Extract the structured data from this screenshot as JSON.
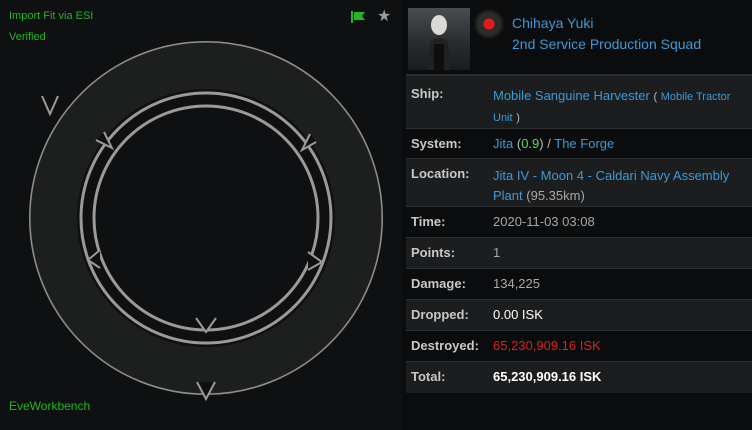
{
  "fitting": {
    "import_link": "Import Fit via ESI",
    "verified": "Verified",
    "eveworkbench": "EveWorkbench"
  },
  "victim": {
    "name": "Chihaya Yuki",
    "corporation": "2nd Service Production Squad"
  },
  "info": {
    "ship_label": "Ship:",
    "ship_name": "Mobile Sanguine Harvester",
    "ship_open_paren": "(",
    "ship_group": "Mobile Tractor Unit",
    "ship_close_paren": ")",
    "system_label": "System:",
    "system_name": "Jita",
    "security_open": "(",
    "security": "0.9",
    "security_close": ")",
    "region_sep": "/",
    "region": "The Forge",
    "location_label": "Location:",
    "location": "Jita IV - Moon 4 - Caldari Navy Assembly Plant",
    "distance": "(95.35km)",
    "time_label": "Time:",
    "time": "2020-11-03 03:08",
    "points_label": "Points:",
    "points": "1",
    "damage_label": "Damage:",
    "damage": "134,225",
    "dropped_label": "Dropped:",
    "dropped": "0.00 ISK",
    "destroyed_label": "Destroyed:",
    "destroyed": "65,230,909.16 ISK",
    "total_label": "Total:",
    "total": "65,230,909.16 ISK"
  },
  "colors": {
    "link": "#3d9ad8",
    "fitting_green": "#27b427",
    "security_green": "#5fdc5f",
    "destroyed_red": "#d7231f"
  },
  "icons": {
    "flag": "flag-icon",
    "star": "star-icon"
  }
}
